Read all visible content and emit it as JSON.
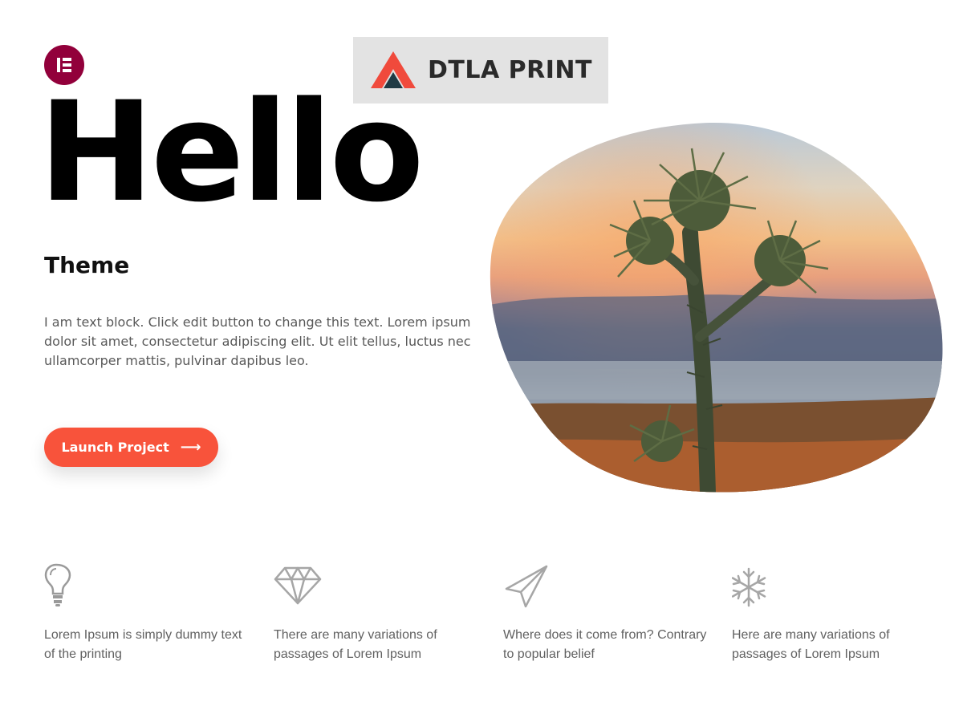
{
  "logo": {
    "icon": "elementor-icon",
    "color": "#92003b"
  },
  "brand": {
    "name": "DTLA PRINT",
    "mark_icon": "mountain-triangle-icon",
    "accent": "#f04a3c"
  },
  "hero": {
    "title": "Hello",
    "subtitle": "Theme",
    "text": "I am text block. Click edit button to change this text. Lorem ipsum dolor sit amet, consectetur adipiscing elit. Ut elit tellus, luctus nec ullamcorper mattis, pulvinar dapibus leo.",
    "button_label": "Launch Project",
    "button_icon": "arrow-right-icon",
    "button_color": "#f8533b",
    "image": "cactus-sunset-photo"
  },
  "features": [
    {
      "icon": "lightbulb-icon",
      "text": "Lorem Ipsum is simply dummy text of the printing"
    },
    {
      "icon": "diamond-icon",
      "text": "There are many variations of passages of Lorem Ipsum"
    },
    {
      "icon": "paper-plane-icon",
      "text": "Where does it come from? Contrary to popular belief"
    },
    {
      "icon": "snowflake-icon",
      "text": "Here are many variations of passages of Lorem Ipsum"
    }
  ]
}
